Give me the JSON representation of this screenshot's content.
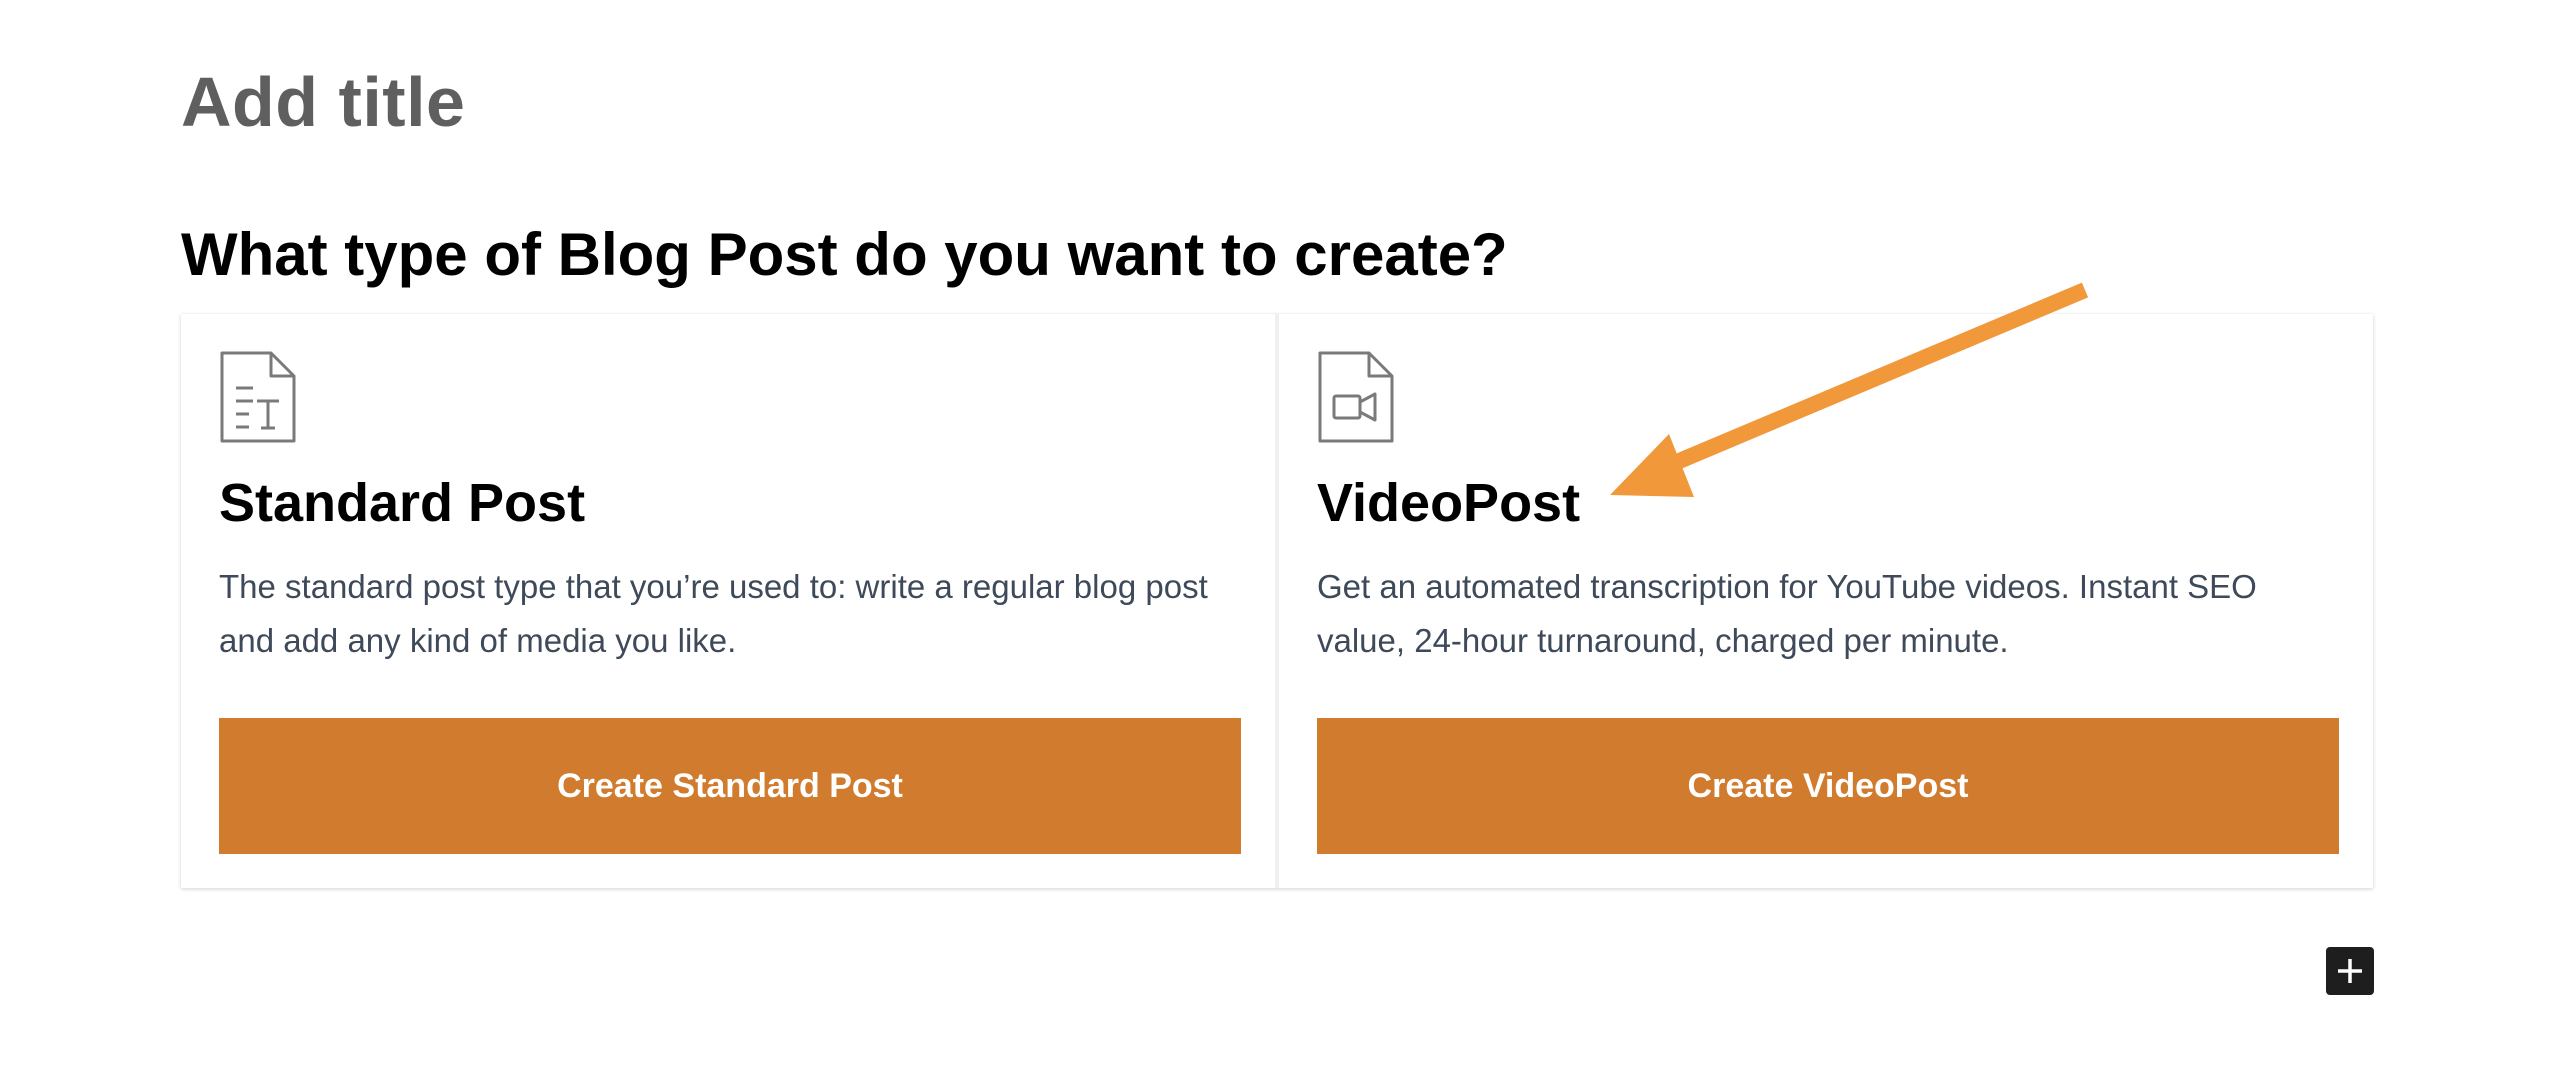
{
  "editor": {
    "title_placeholder": "Add title"
  },
  "chooser": {
    "question": "What type of Blog Post do you want to create?",
    "accent_color": "#d17b2e",
    "cards": [
      {
        "icon": "text-document-icon",
        "title": "Standard Post",
        "description": "The standard post type that you’re used to: write a regular blog post and add any kind of media you like.",
        "button_label": "Create Standard Post"
      },
      {
        "icon": "video-document-icon",
        "title": "VideoPost",
        "description": "Get an automated transcription for YouTube videos. Instant SEO value, 24-hour turnaround, charged per minute.",
        "button_label": "Create VideoPost"
      }
    ]
  },
  "annotation": {
    "arrow_color": "#f0983a",
    "icon": "arrow-pointer-icon"
  },
  "toolbar": {
    "add_block_icon": "plus-icon"
  }
}
